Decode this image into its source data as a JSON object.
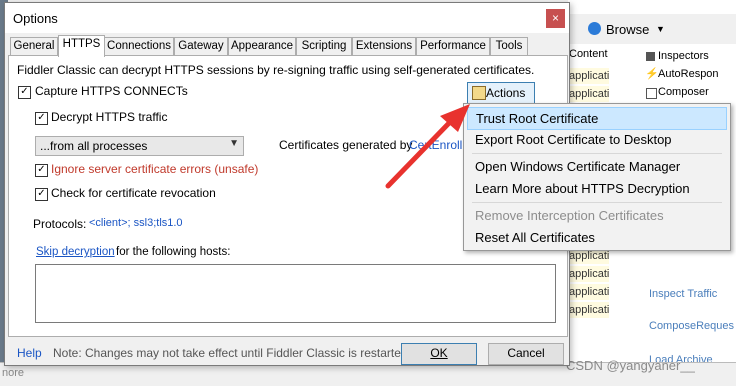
{
  "background": {
    "browse_label": "Browse",
    "content_header": "Content",
    "content_cells": [
      "applicati",
      "applicati",
      "applicati",
      "applicati",
      "applicati",
      "applicati",
      "applicati",
      "applicati",
      "applicati",
      "applicati",
      "applicati",
      "applicati",
      "applicati",
      "applicati"
    ],
    "inspectors": [
      "Inspectors",
      "AutoRespon",
      "Composer"
    ],
    "side_links": [
      "Inspect Traffic",
      "ComposeReques",
      "Load Archive"
    ],
    "bottom_left": "nore"
  },
  "watermark": "CSDN @yangyaner__",
  "dialog": {
    "title": "Options",
    "close_glyph": "×",
    "tabs": [
      "General",
      "HTTPS",
      "Connections",
      "Gateway",
      "Appearance",
      "Scripting",
      "Extensions",
      "Performance",
      "Tools"
    ],
    "intro": "Fiddler Classic can decrypt HTTPS sessions by re-signing traffic using self-generated certificates.",
    "capture_label": "Capture HTTPS CONNECTs",
    "decrypt_label": "Decrypt HTTPS traffic",
    "process_value": "...from all processes",
    "cert_generated_prefix": "Certificates generated by",
    "cert_generated_link": "CertEnroll",
    "ignore_label": "Ignore server certificate errors (unsafe)",
    "revocation_label": "Check for certificate revocation",
    "protocols_label": "Protocols:",
    "protocols_value": "<client>; ssl3;tls1.0",
    "skip_link": "Skip decryption",
    "skip_suffix": "for the following hosts:",
    "actions_label": "Actions",
    "help_label": "Help",
    "note": "Note: Changes may not take effect until Fiddler Classic is restarted.",
    "ok_label": "OK",
    "cancel_label": "Cancel"
  },
  "menu": {
    "items": [
      {
        "label": "Trust Root Certificate",
        "state": "highlighted"
      },
      {
        "label": "Export Root Certificate to Desktop",
        "state": "normal"
      },
      {
        "label": "Open Windows Certificate Manager",
        "state": "normal"
      },
      {
        "label": "Learn More about HTTPS Decryption",
        "state": "normal"
      },
      {
        "label": "Remove Interception Certificates",
        "state": "disabled"
      },
      {
        "label": "Reset All Certificates",
        "state": "normal"
      }
    ]
  },
  "colors": {
    "arrow": "#e8322e",
    "highlight": "#cce8ff",
    "link": "#1a55c4",
    "error": "#c0392b"
  }
}
